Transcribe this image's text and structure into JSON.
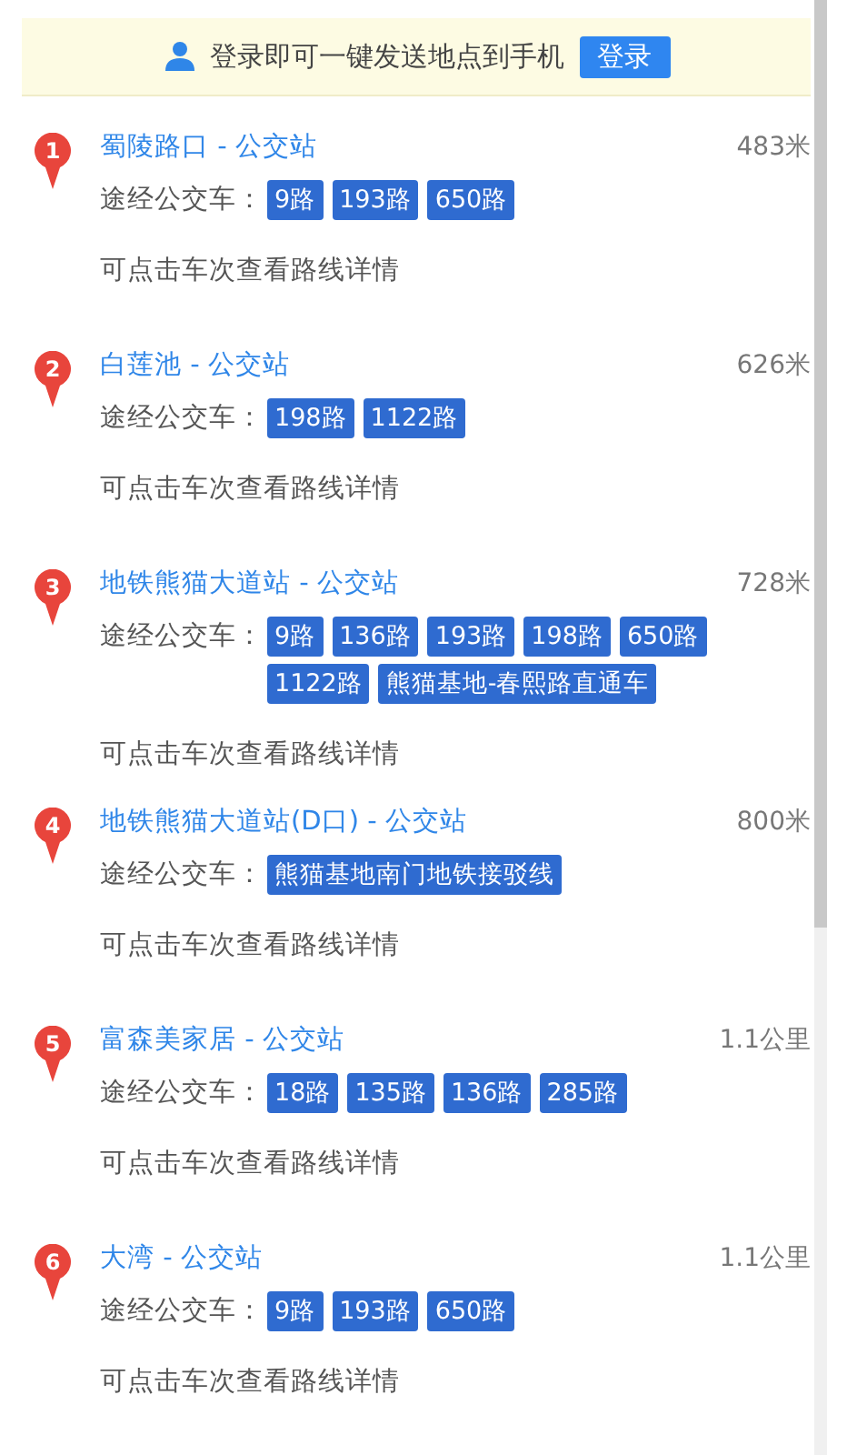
{
  "login_banner": {
    "message": "登录即可一键发送地点到手机",
    "button": "登录"
  },
  "stations": [
    {
      "number": "1",
      "name": "蜀陵路口 - 公交站",
      "distance": "483米",
      "buses_label": "途经公交车：",
      "buses": [
        "9路",
        "193路",
        "650路"
      ],
      "hint": "可点击车次查看路线详情"
    },
    {
      "number": "2",
      "name": "白莲池 - 公交站",
      "distance": "626米",
      "buses_label": "途经公交车：",
      "buses": [
        "198路",
        "1122路"
      ],
      "hint": "可点击车次查看路线详情"
    },
    {
      "number": "3",
      "name": "地铁熊猫大道站 - 公交站",
      "distance": "728米",
      "buses_label": "途经公交车：",
      "buses": [
        "9路",
        "136路",
        "193路",
        "198路",
        "650路",
        "1122路",
        "熊猫基地-春熙路直通车"
      ],
      "hint": "可点击车次查看路线详情"
    },
    {
      "number": "4",
      "name": "地铁熊猫大道站(D口) - 公交站",
      "distance": "800米",
      "buses_label": "途经公交车：",
      "buses": [
        "熊猫基地南门地铁接驳线"
      ],
      "hint": "可点击车次查看路线详情"
    },
    {
      "number": "5",
      "name": "富森美家居 - 公交站",
      "distance": "1.1公里",
      "buses_label": "途经公交车：",
      "buses": [
        "18路",
        "135路",
        "136路",
        "285路"
      ],
      "hint": "可点击车次查看路线详情"
    },
    {
      "number": "6",
      "name": "大湾 - 公交站",
      "distance": "1.1公里",
      "buses_label": "途经公交车：",
      "buses": [
        "9路",
        "193路",
        "650路"
      ],
      "hint": "可点击车次查看路线详情"
    }
  ]
}
